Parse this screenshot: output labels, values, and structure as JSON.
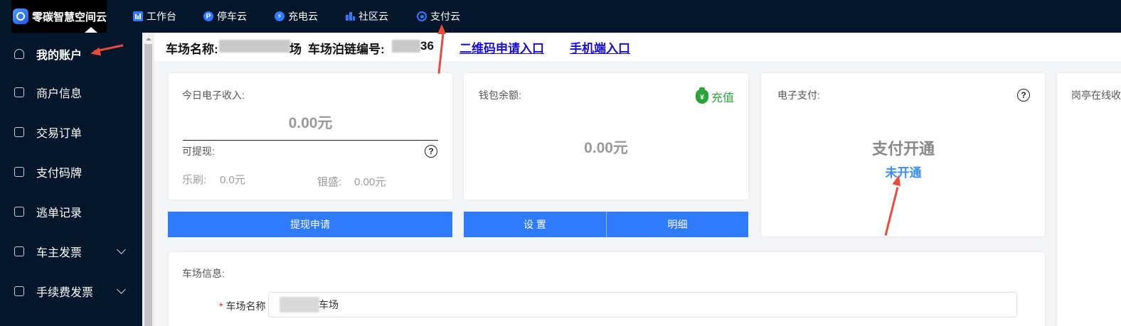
{
  "topbar": {
    "brand": "零碳智慧空间云",
    "nav": [
      {
        "label": "工作台",
        "icon": "dashboard-icon"
      },
      {
        "label": "停车云",
        "icon": "parking-icon"
      },
      {
        "label": "充电云",
        "icon": "charging-icon"
      },
      {
        "label": "社区云",
        "icon": "community-icon"
      },
      {
        "label": "支付云",
        "icon": "payment-icon"
      }
    ]
  },
  "sidebar": {
    "items": [
      {
        "label": "我的账户",
        "icon": "account-icon",
        "active": true
      },
      {
        "label": "商户信息",
        "icon": "merchant-icon"
      },
      {
        "label": "交易订单",
        "icon": "order-icon"
      },
      {
        "label": "支付码牌",
        "icon": "qrcode-icon"
      },
      {
        "label": "逃单记录",
        "icon": "record-icon"
      },
      {
        "label": "车主发票",
        "icon": "invoice-icon",
        "expandable": true
      },
      {
        "label": "手续费发票",
        "icon": "fee-invoice-icon",
        "expandable": true
      }
    ]
  },
  "info": {
    "lot_name_label": "车场名称:",
    "lot_name_suffix": "场",
    "chain_no_label": "车场泊链编号:",
    "chain_no_suffix": "36",
    "qr_link": "二维码申请入口",
    "mobile_link": "手机端入口"
  },
  "income_card": {
    "title": "今日电子收入:",
    "amount": "0.00元",
    "withdrawable_label": "可提现:",
    "leshua_label": "乐刷:",
    "leshua_value": "0.0元",
    "yinsheng_label": "银盛:",
    "yinsheng_value": "0.00元",
    "withdraw_button": "提现申请"
  },
  "wallet_card": {
    "title": "钱包余额:",
    "recharge": "充值",
    "amount": "0.00元",
    "settings_button": "设 置",
    "detail_button": "明细"
  },
  "epay_card": {
    "title": "电子支付:",
    "status_title": "支付开通",
    "status": "未开通"
  },
  "kiosk_card": {
    "title": "岗亭在线收"
  },
  "form": {
    "section_title": "车场信息:",
    "lot_name_label": "车场名称",
    "lot_name_value": "车场"
  },
  "colors": {
    "topbar": "#04162c",
    "accent": "#2f7bff",
    "recharge": "#2aa43a",
    "annotation": "#e84a3c"
  }
}
